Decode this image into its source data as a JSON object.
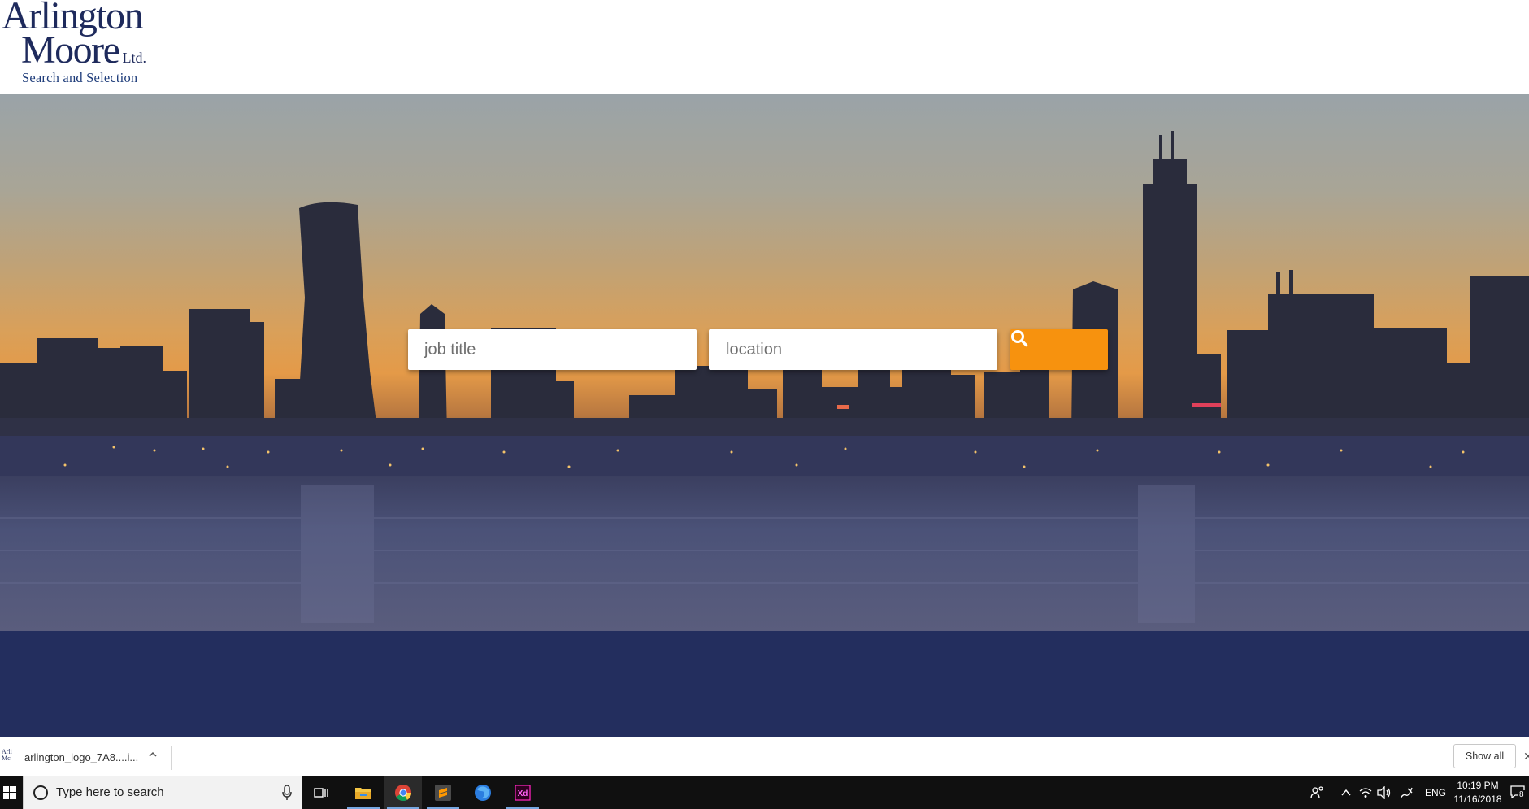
{
  "logo": {
    "line1": "Arlington",
    "line2": "Moore",
    "ltd": "Ltd.",
    "tagline": "Search and Selection"
  },
  "search": {
    "job_placeholder": "job title",
    "location_placeholder": "location",
    "button_icon": "search-icon",
    "button_color": "#f7920e"
  },
  "colors": {
    "navy_band": "#232e5e",
    "logo_text": "#1e2a5c"
  },
  "downloads": {
    "file_name": "arlington_logo_7A8....i...",
    "show_all_label": "Show all",
    "close_label": "✕"
  },
  "taskbar": {
    "search_placeholder": "Type here to search",
    "apps": [
      "task-view-icon",
      "file-explorer-icon",
      "chrome-icon",
      "sublime-text-icon",
      "firefox-icon",
      "adobe-xd-icon"
    ],
    "language": "ENG",
    "time": "10:19 PM",
    "date": "11/16/2018",
    "notification_count": "8"
  }
}
